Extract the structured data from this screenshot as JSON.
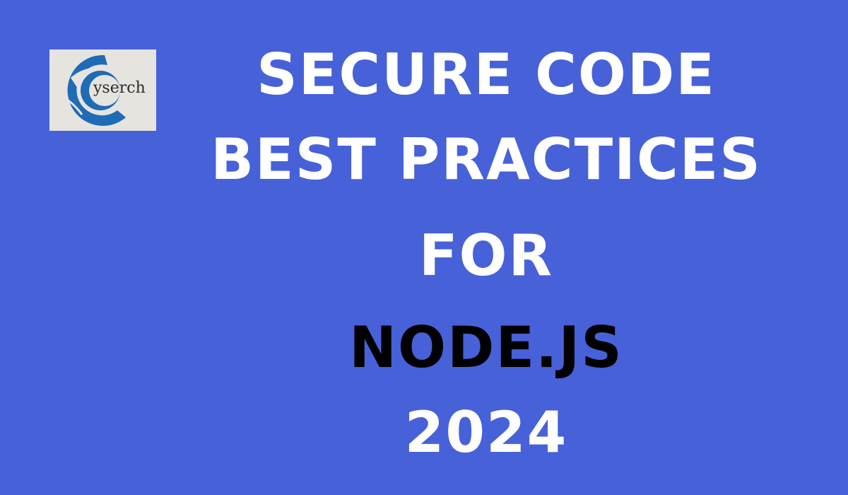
{
  "logo": {
    "text": "yserch",
    "brand_color": "#1f6bb5"
  },
  "title": {
    "line1": "SECURE CODE",
    "line2": "BEST PRACTICES",
    "line3": "FOR",
    "line4": "NODE.JS",
    "line5": "2024"
  },
  "colors": {
    "background": "#4761d8",
    "text": "#ffffff",
    "highlight": "#000000"
  }
}
